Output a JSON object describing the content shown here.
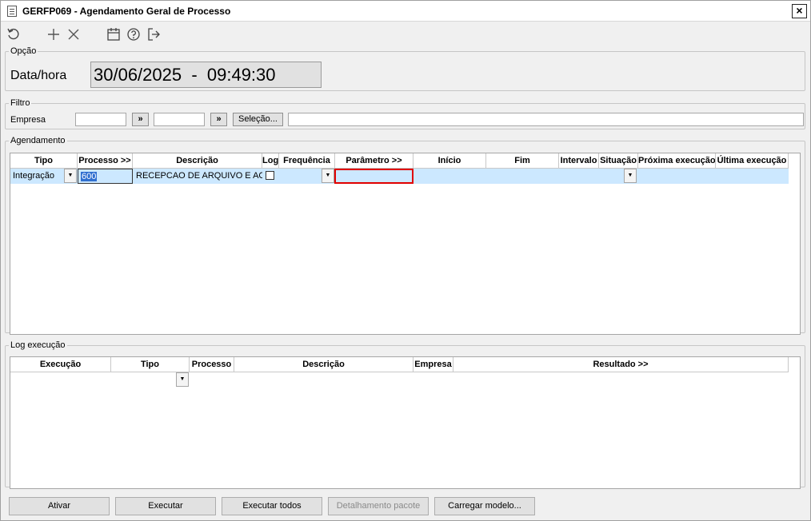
{
  "window": {
    "title": "GERFP069 - Agendamento Geral de Processo",
    "close_label": "×"
  },
  "toolbar": {
    "icons": [
      "refresh-icon",
      "add-icon",
      "delete-icon",
      "calendar-icon",
      "help-icon",
      "exit-icon"
    ]
  },
  "opcao": {
    "legend": "Opção",
    "label": "Data/hora",
    "value": "30/06/2025  -  09:49:30"
  },
  "filtro": {
    "legend": "Filtro",
    "empresa_label": "Empresa",
    "from_value": "",
    "to_value": "",
    "lookup_label": "»",
    "selecao_label": "Seleção...",
    "selection_text": ""
  },
  "agendamento": {
    "legend": "Agendamento",
    "columns": [
      "Tipo",
      "Processo >>",
      "Descrição",
      "Log",
      "Frequência",
      "Parâmetro >>",
      "Início",
      "Fim",
      "Intervalo",
      "Situação",
      "Próxima execução",
      "Última execução"
    ],
    "row": {
      "tipo": "Integração",
      "processo": "600",
      "descricao": "RECEPCAO DE ARQUIVO E ACEI",
      "log_checked": false,
      "frequencia": "",
      "parametro": "",
      "inicio": "",
      "fim": "",
      "intervalo": "",
      "situacao": "",
      "proxima": "",
      "ultima": ""
    }
  },
  "log": {
    "legend": "Log execução",
    "columns": [
      "Execução",
      "Tipo",
      "Processo",
      "Descrição",
      "Empresa",
      "Resultado >>"
    ]
  },
  "footer": {
    "ativar": "Ativar",
    "executar": "Executar",
    "executar_todos": "Executar todos",
    "detalhamento": "Detalhamento pacote",
    "carregar": "Carregar modelo..."
  },
  "colors": {
    "selected_row": "#cce8ff",
    "active_cell_border": "#e00000"
  }
}
